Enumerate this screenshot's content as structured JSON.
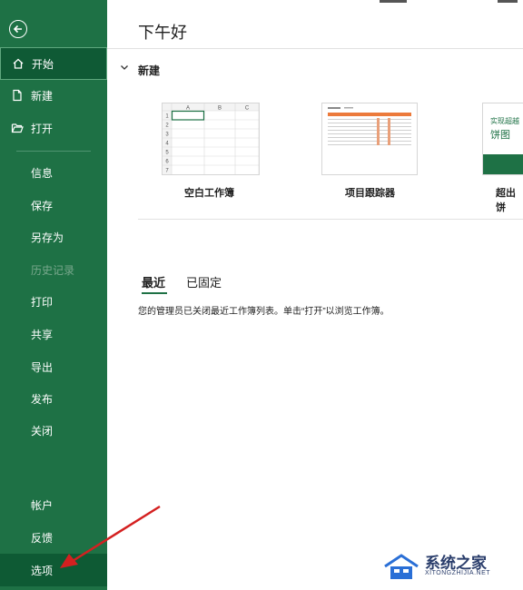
{
  "sidebar": {
    "back_icon": "back-arrow-icon",
    "primary": [
      {
        "label": "开始",
        "icon": "home-icon",
        "state": "active"
      },
      {
        "label": "新建",
        "icon": "new-document-icon"
      },
      {
        "label": "打开",
        "icon": "folder-open-icon"
      }
    ],
    "items": [
      {
        "label": "信息"
      },
      {
        "label": "保存"
      },
      {
        "label": "另存为"
      },
      {
        "label": "历史记录",
        "state": "disabled"
      },
      {
        "label": "打印"
      },
      {
        "label": "共享"
      },
      {
        "label": "导出"
      },
      {
        "label": "发布"
      },
      {
        "label": "关闭"
      }
    ],
    "bottom": [
      {
        "label": "帐户"
      },
      {
        "label": "反馈"
      },
      {
        "label": "选项",
        "state": "highlighted"
      }
    ]
  },
  "main": {
    "greeting": "下午好",
    "new_section": "新建",
    "templates": [
      {
        "label": "空白工作簿"
      },
      {
        "label": "项目跟踪器"
      },
      {
        "label": "超出饼",
        "thumb_line1": "实现超越",
        "thumb_line2": "饼图"
      }
    ],
    "blank_sheet": {
      "columns": [
        "A",
        "B",
        "C"
      ],
      "rows": [
        "1",
        "2",
        "3",
        "4",
        "5",
        "6",
        "7"
      ]
    },
    "tabs": [
      {
        "label": "最近"
      },
      {
        "label": "已固定"
      }
    ],
    "notice": "您的管理员已关闭最近工作簿列表。单击“打开”以浏览工作簿。"
  },
  "watermark": {
    "title": "系统之家",
    "url": "XITONGZHIJIA.NET"
  },
  "colors": {
    "sidebar_bg": "#1e7145",
    "active_bg": "#0f5a35",
    "accent": "#1e7145",
    "arrow": "#d42020"
  }
}
